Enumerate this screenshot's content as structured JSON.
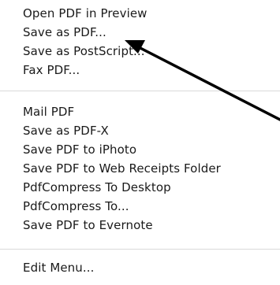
{
  "menu": {
    "group1": [
      {
        "label": "Open PDF in Preview"
      },
      {
        "label": "Save as PDF..."
      },
      {
        "label": "Save as PostScript..."
      },
      {
        "label": "Fax PDF..."
      }
    ],
    "group2": [
      {
        "label": "Mail PDF"
      },
      {
        "label": "Save as PDF-X"
      },
      {
        "label": "Save PDF to iPhoto"
      },
      {
        "label": "Save PDF to Web Receipts Folder"
      },
      {
        "label": "PdfCompress To Desktop"
      },
      {
        "label": "PdfCompress To..."
      },
      {
        "label": "Save PDF to Evernote"
      }
    ],
    "group3": [
      {
        "label": "Edit Menu..."
      }
    ]
  },
  "annotation": {
    "arrow_color": "#000000",
    "points_to": "Save as PDF..."
  }
}
